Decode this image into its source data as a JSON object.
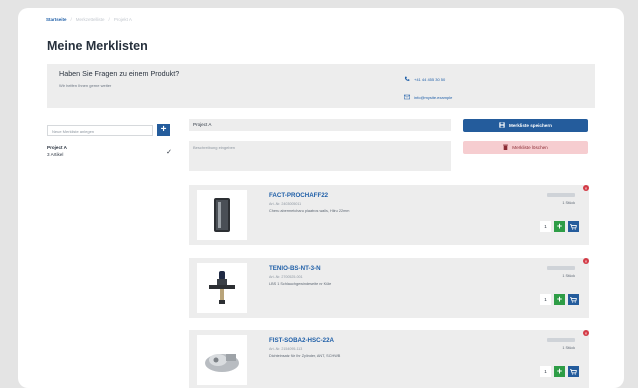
{
  "breadcrumb": {
    "items": [
      "Startseite",
      "Merkzettelliste",
      "Projekt A"
    ],
    "separator": "/"
  },
  "page_title": "Meine Merklisten",
  "help": {
    "heading": "Haben Sie Fragen zu einem Produkt?",
    "subtext": "Wir helfen Ihnen gerne weiter",
    "phone": "+41 44 455 30 50",
    "email": "info@mysite.example"
  },
  "sidebar": {
    "new_list_placeholder": "Neue Merkliste anlegen",
    "lists": [
      {
        "name": "Project A",
        "count": "3 Artikel",
        "selected": true
      }
    ]
  },
  "editor": {
    "name_value": "Project A",
    "description_placeholder": "Beschreibung eingeben",
    "save_label": "Merkliste speichern",
    "delete_label": "Merkliste löschen"
  },
  "products": [
    {
      "name": "FACT-PROCHAFF22",
      "article": "Art.-Nr. 2403005011",
      "description": "Cheru abermetcharu plaatros walls, Hiiru 22mm",
      "unit": "1 Stück",
      "quantity": "1",
      "icon": "cylinder-filter"
    },
    {
      "name": "TENIO-BS-NT-3-N",
      "article": "Art.-Nr. 2700525-001",
      "description": "LBS 1 Schlauchgewindeseite nr Küle",
      "unit": "1 Stück",
      "quantity": "1",
      "icon": "valve-connector"
    },
    {
      "name": "FIST-SOBA2-HSC-22A",
      "article": "Art.-Nr. 2154095-113",
      "description": "Dichteinsatz für Ihr Zylinder, ANT, SCHWB",
      "unit": "1 Stück",
      "quantity": "1",
      "icon": "pump-part"
    }
  ],
  "colors": {
    "primary": "#245c9c",
    "green": "#2e9d46",
    "danger": "#d33a46",
    "danger_light": "#f6cdd0",
    "panel": "#ededed"
  }
}
